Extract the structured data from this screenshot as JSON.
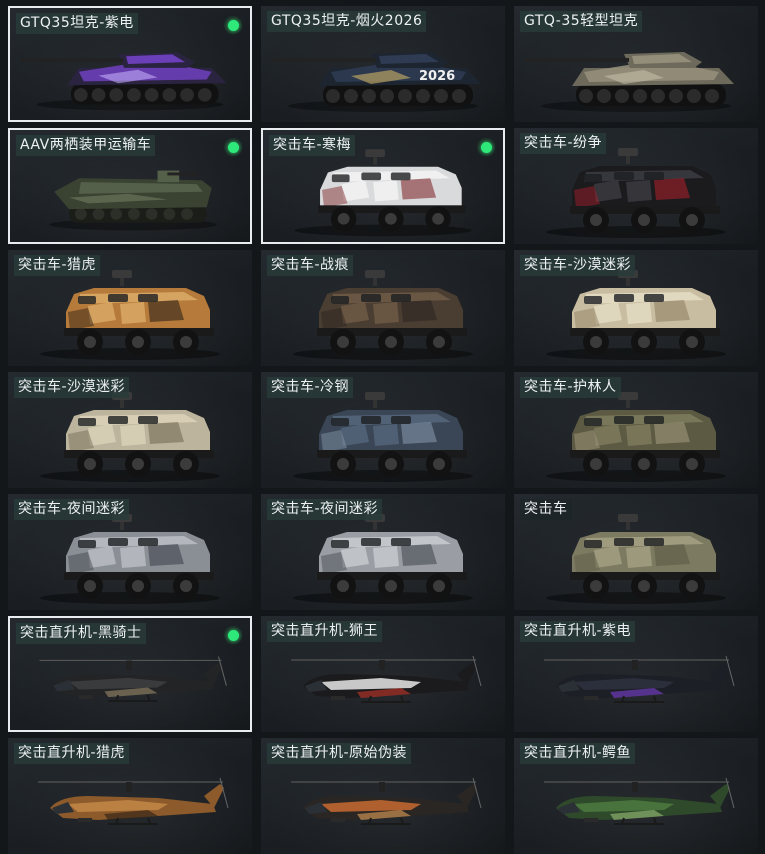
{
  "vehicles": [
    {
      "label": "GTQ35坦克-紫电",
      "kind": "tank",
      "selected": true,
      "equipped": true,
      "c1": "#2a2440",
      "c2": "#6b3fb8",
      "c3": "#c9b7ff"
    },
    {
      "label": "GTQ35坦克-烟火2026",
      "kind": "tank",
      "selected": false,
      "equipped": false,
      "c1": "#1d2530",
      "c2": "#2e3b52",
      "c3": "#e0c06a",
      "text": "2026"
    },
    {
      "label": "GTQ-35轻型坦克",
      "kind": "tank",
      "selected": false,
      "equipped": false,
      "c1": "#6d6a5c",
      "c2": "#938e7a",
      "c3": "#c8c2ad"
    },
    {
      "label": "AAV两栖装甲运输车",
      "kind": "aav",
      "selected": true,
      "equipped": true,
      "c1": "#3a4232",
      "c2": "#55604a",
      "c3": "#7c8769"
    },
    {
      "label": "突击车-寒梅",
      "kind": "truck",
      "selected": true,
      "equipped": true,
      "c1": "#d9dadb",
      "c2": "#f2f2f2",
      "c3": "#7a1d22"
    },
    {
      "label": "突击车-纷争",
      "kind": "truck",
      "selected": false,
      "equipped": false,
      "c1": "#1b1b1e",
      "c2": "#3a3a40",
      "c3": "#b0202a"
    },
    {
      "label": "突击车-猎虎",
      "kind": "truck",
      "selected": false,
      "equipped": false,
      "c1": "#b67a3a",
      "c2": "#d9a866",
      "c3": "#231b15"
    },
    {
      "label": "突击车-战痕",
      "kind": "truck",
      "selected": false,
      "equipped": false,
      "c1": "#4a3d31",
      "c2": "#6d5a47",
      "c3": "#2a2420"
    },
    {
      "label": "突击车-沙漠迷彩",
      "kind": "truck",
      "selected": false,
      "equipped": false,
      "c1": "#c9bda1",
      "c2": "#e3dac3",
      "c3": "#8a7b5d"
    },
    {
      "label": "突击车-沙漠迷彩",
      "kind": "truck",
      "selected": false,
      "equipped": false,
      "c1": "#bdb49d",
      "c2": "#d9d0b8",
      "c3": "#6f6650"
    },
    {
      "label": "突击车-冷钢",
      "kind": "truck",
      "selected": false,
      "equipped": false,
      "c1": "#3a4655",
      "c2": "#55657a",
      "c3": "#8a9bb0"
    },
    {
      "label": "突击车-护林人",
      "kind": "truck",
      "selected": false,
      "equipped": false,
      "c1": "#5d5a43",
      "c2": "#7c7a5c",
      "c3": "#a39d80"
    },
    {
      "label": "突击车-夜间迷彩",
      "kind": "truck",
      "selected": false,
      "equipped": false,
      "c1": "#8a8f96",
      "c2": "#b8bcc2",
      "c3": "#3b4048"
    },
    {
      "label": "突击车-夜间迷彩",
      "kind": "truck",
      "selected": false,
      "equipped": false,
      "c1": "#9a9ea4",
      "c2": "#c6c9ce",
      "c3": "#40454c"
    },
    {
      "label": "突击车",
      "kind": "truck",
      "selected": false,
      "equipped": false,
      "plain": true,
      "c1": "#7c7a60",
      "c2": "#a29f83",
      "c3": "#5a5844"
    },
    {
      "label": "突击直升机-黑骑士",
      "kind": "heli",
      "selected": true,
      "equipped": true,
      "c1": "#232426",
      "c2": "#3e3f42",
      "c3": "#9a8a6a"
    },
    {
      "label": "突击直升机-狮王",
      "kind": "heli",
      "selected": false,
      "equipped": false,
      "c1": "#1b1b1d",
      "c2": "#e6e6e6",
      "c3": "#c8352a"
    },
    {
      "label": "突击直升机-紫电",
      "kind": "heli",
      "selected": false,
      "equipped": false,
      "c1": "#1d1f26",
      "c2": "#2e3140",
      "c3": "#7b3fd1"
    },
    {
      "label": "突击直升机-猎虎",
      "kind": "heli",
      "selected": false,
      "equipped": false,
      "c1": "#8c5a2b",
      "c2": "#c28848",
      "c3": "#2a1e14"
    },
    {
      "label": "突击直升机-原始伪装",
      "kind": "heli",
      "selected": false,
      "equipped": false,
      "c1": "#2a2623",
      "c2": "#c86a30",
      "c3": "#e3a15a"
    },
    {
      "label": "突击直升机-鳄鱼",
      "kind": "heli",
      "selected": false,
      "equipped": false,
      "c1": "#2f4a2a",
      "c2": "#4c7a3f",
      "c3": "#9bc27a"
    }
  ]
}
